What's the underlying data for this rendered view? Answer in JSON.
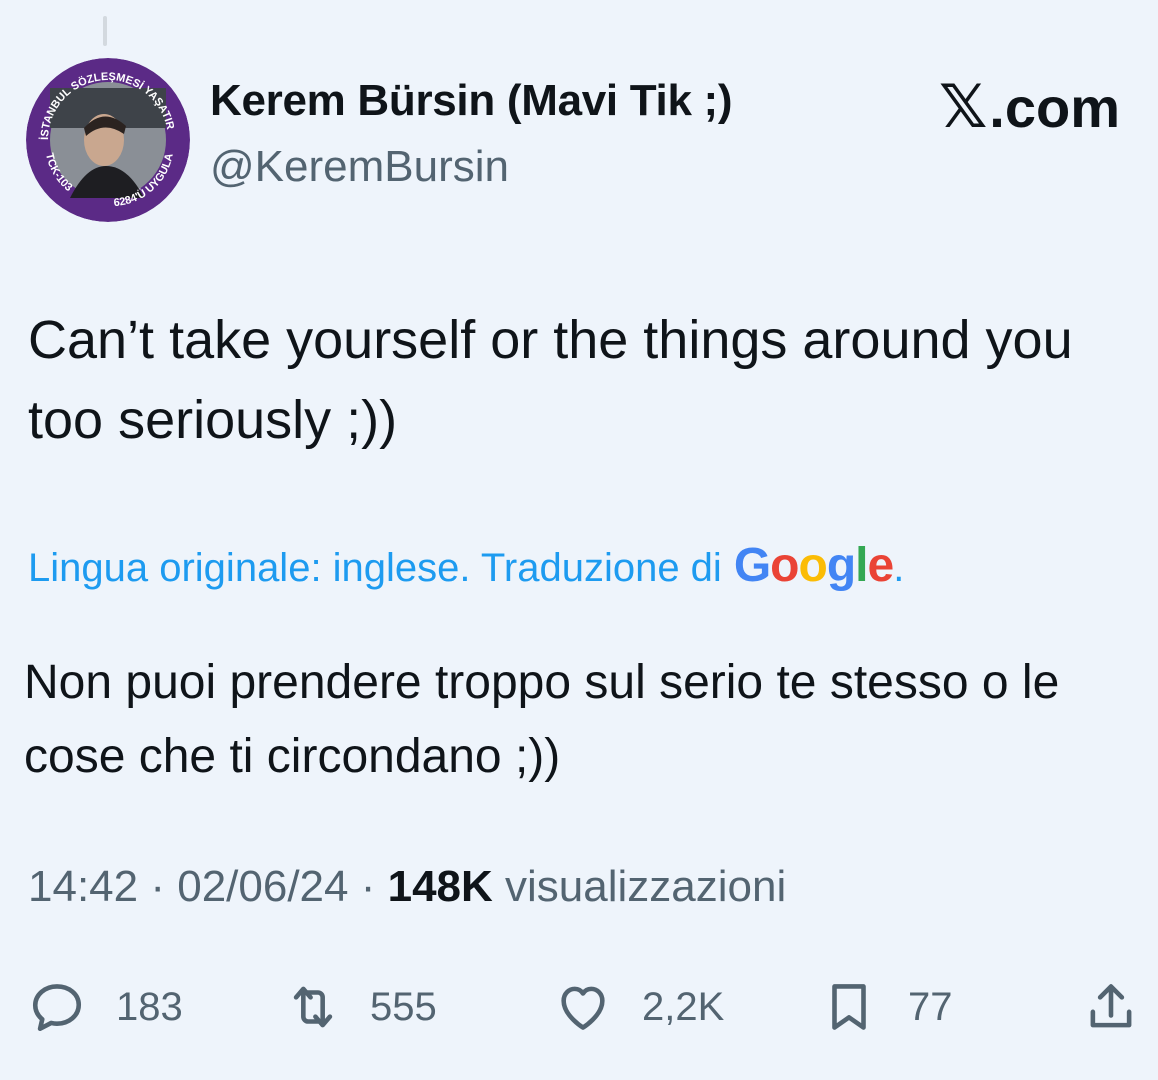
{
  "author": {
    "name": "Kerem Bürsin (Mavi Tik ;)",
    "handle": "@KeremBursin",
    "avatar_badge": {
      "top_text": "İSTANBUL SÖZLEŞMESİ YAŞATIR",
      "left_text": "TCK-103",
      "right_text": "6284'Ü UYGULA",
      "ring_color": "#5b2a86"
    }
  },
  "watermark": {
    "logo": "𝕏",
    "text": ".com"
  },
  "tweet": {
    "text": "Can’t take yourself or the things around you too seriously ;))",
    "translation_note": "Lingua originale: inglese. Traduzione di",
    "google_letters": [
      "G",
      "o",
      "o",
      "g",
      "l",
      "e"
    ],
    "translation_period": ".",
    "translated_text": "Non puoi prendere troppo sul serio te stesso o le cose che ti circondano ;))"
  },
  "meta": {
    "time": "14:42",
    "sep1": " · ",
    "date": "02/06/24",
    "sep2": " · ",
    "views_count": "148K",
    "views_label": " visualizzazioni"
  },
  "actions": {
    "replies": "183",
    "reposts": "555",
    "likes": "2,2K",
    "bookmarks": "77"
  },
  "colors": {
    "background": "#eef4fb",
    "link": "#1d9bf0",
    "secondary_text": "#536471",
    "primary_text": "#0f1419"
  }
}
